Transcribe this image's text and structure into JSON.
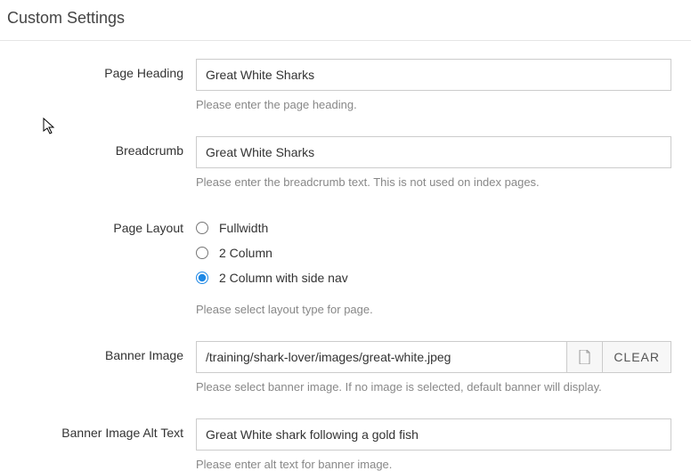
{
  "title": "Custom Settings",
  "fields": {
    "pageHeading": {
      "label": "Page Heading",
      "value": "Great White Sharks",
      "hint": "Please enter the page heading."
    },
    "breadcrumb": {
      "label": "Breadcrumb",
      "value": "Great White Sharks",
      "hint": "Please enter the breadcrumb text. This is not used on index pages."
    },
    "pageLayout": {
      "label": "Page Layout",
      "options": {
        "opt0": "Fullwidth",
        "opt1": "2 Column",
        "opt2": "2 Column with side nav"
      },
      "hint": "Please select layout type for page."
    },
    "bannerImage": {
      "label": "Banner Image",
      "value": "/training/shark-lover/images/great-white.jpeg",
      "clear": "CLEAR",
      "hint": "Please select banner image. If no image is selected, default banner will display."
    },
    "bannerAlt": {
      "label": "Banner Image Alt Text",
      "value": "Great White shark following a gold fish",
      "hint": "Please enter alt text for banner image."
    }
  }
}
